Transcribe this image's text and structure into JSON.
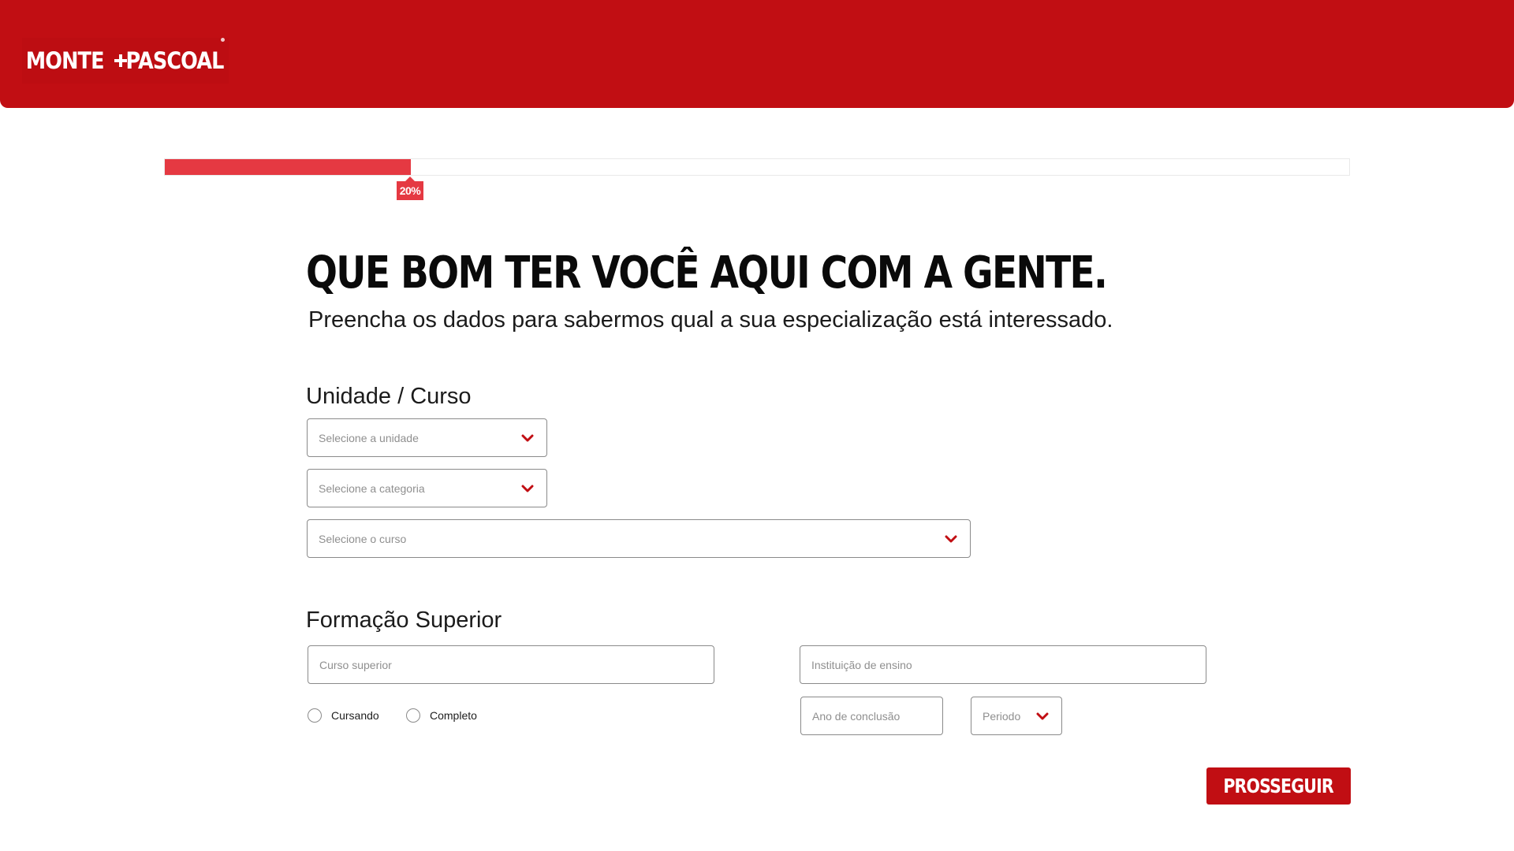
{
  "header": {
    "logo_text_left": "MONTE",
    "logo_text_right": "PASCOAL",
    "brand_color": "#c10e13"
  },
  "progress": {
    "percent": 20,
    "label": "20%",
    "fill_color": "#e53942"
  },
  "intro": {
    "headline": "QUE BOM TER VOCÊ AQUI COM A GENTE.",
    "subtitle": "Preencha os dados para sabermos qual a sua especialização está interessado."
  },
  "unit_course": {
    "title": "Unidade / Curso",
    "unit_placeholder": "Selecione a unidade",
    "category_placeholder": "Selecione a categoria",
    "course_placeholder": "Selecione o curso"
  },
  "higher_education": {
    "title": "Formação Superior",
    "course_placeholder": "Curso superior",
    "institution_placeholder": "Instituição de ensino",
    "status_options": [
      "Cursando",
      "Completo"
    ],
    "year_placeholder": "Ano de conclusão",
    "period_placeholder": "Periodo"
  },
  "actions": {
    "submit_label": "PROSSEGUIR"
  },
  "icons": {
    "dropdown": "chevron-down-icon",
    "logo_mark": "cross-icon"
  }
}
